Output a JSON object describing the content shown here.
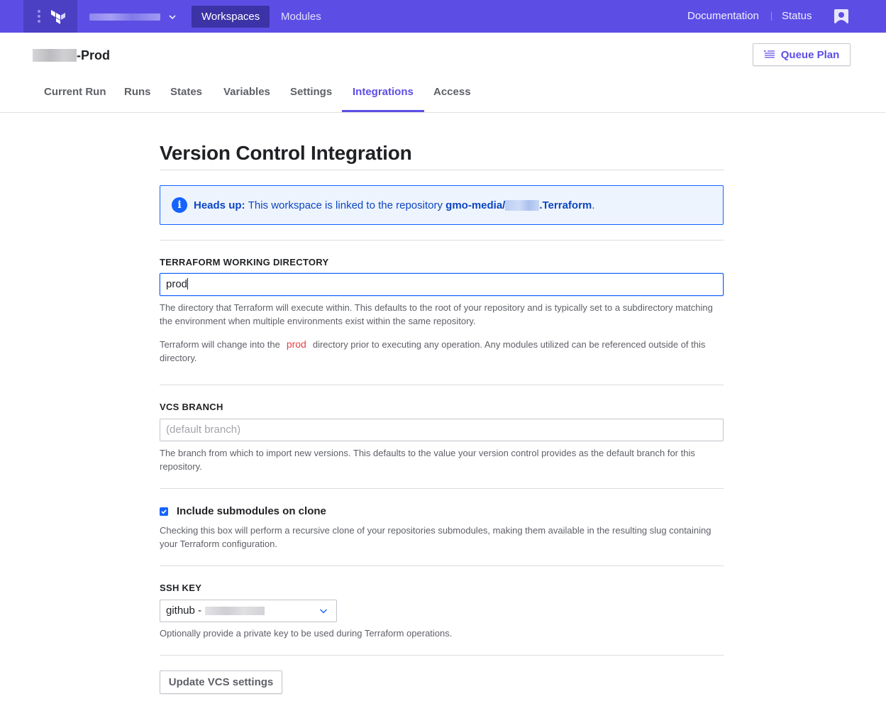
{
  "topnav": {
    "tabs": [
      {
        "label": "Workspaces",
        "active": true
      },
      {
        "label": "Modules",
        "active": false
      }
    ],
    "links": [
      "Documentation",
      "Status"
    ],
    "colors": {
      "nav_bg": "#5c4ee5",
      "brand_bg": "#4b3fc4",
      "active_tab_bg": "#3c33a7"
    }
  },
  "workspace": {
    "name_suffix": "-Prod",
    "queue_plan_label": "Queue Plan"
  },
  "tabs": [
    {
      "label": "Current Run",
      "active": false
    },
    {
      "label": "Runs",
      "active": false
    },
    {
      "label": "States",
      "active": false
    },
    {
      "label": "Variables",
      "active": false
    },
    {
      "label": "Settings",
      "active": false
    },
    {
      "label": "Integrations",
      "active": true
    },
    {
      "label": "Access",
      "active": false
    }
  ],
  "page": {
    "title": "Version Control Integration"
  },
  "alert": {
    "lead": "Heads up:",
    "text": "This workspace is linked to the repository",
    "repo_prefix": "gmo-media/",
    "repo_suffix": ".Terraform",
    "end": "."
  },
  "working_directory": {
    "label": "TERRAFORM WORKING DIRECTORY",
    "value": "prod",
    "help1": "The directory that Terraform will execute within. This defaults to the root of your repository and is typically set to a subdirectory matching the environment when multiple environments exist within the same repository.",
    "help2_pre": "Terraform will change into the",
    "help2_code": "prod",
    "help2_post": "directory prior to executing any operation. Any modules utilized can be referenced outside of this directory."
  },
  "vcs_branch": {
    "label": "VCS BRANCH",
    "placeholder": "(default branch)",
    "help": "The branch from which to import new versions. This defaults to the value your version control provides as the default branch for this repository."
  },
  "submodules": {
    "checked": true,
    "label": "Include submodules on clone",
    "help": "Checking this box will perform a recursive clone of your repositories submodules, making them available in the resulting slug containing your Terraform configuration."
  },
  "ssh_key": {
    "label": "SSH KEY",
    "selected_prefix": "github -",
    "help": "Optionally provide a private key to be used during Terraform operations."
  },
  "update_button_label": "Update VCS settings"
}
